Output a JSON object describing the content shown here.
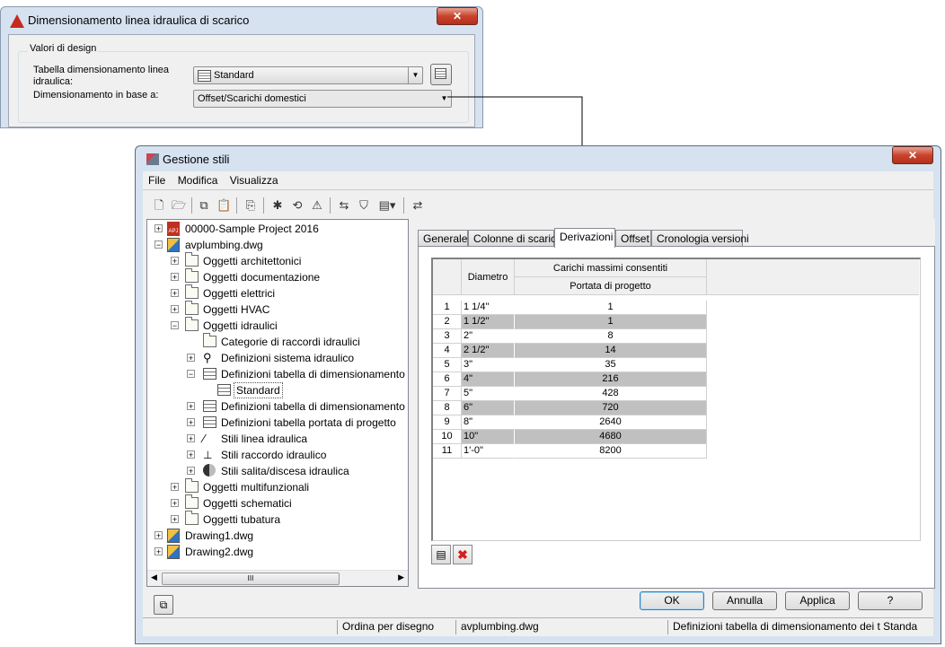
{
  "dialog1": {
    "title": "Dimensionamento linea idraulica di scarico",
    "close": "✕",
    "group_label": "Valori di design",
    "field1_label": "Tabella dimensionamento linea idraulica:",
    "field1_value": "Standard",
    "field2_label": "Dimensionamento in base a:",
    "field2_value": "Offset/Scarichi domestici"
  },
  "dialog2": {
    "title": "Gestione stili",
    "close": "✕",
    "menu": [
      "File",
      "Modifica",
      "Visualizza"
    ],
    "tree": [
      {
        "label": "00000-Sample Project 2016",
        "icon": "project-icon"
      },
      {
        "label": "avplumbing.dwg",
        "icon": "drawing-icon"
      },
      {
        "label": "Oggetti architettonici",
        "icon": "folder-icon"
      },
      {
        "label": "Oggetti documentazione",
        "icon": "folder-icon"
      },
      {
        "label": "Oggetti elettrici",
        "icon": "folder-icon"
      },
      {
        "label": "Oggetti HVAC",
        "icon": "folder-icon"
      },
      {
        "label": "Oggetti idraulici",
        "icon": "folder-icon"
      },
      {
        "label": "Categorie di raccordi idraulici",
        "icon": "category-icon"
      },
      {
        "label": "Definizioni sistema idraulico",
        "icon": "system-icon"
      },
      {
        "label": "Definizioni tabella di dimensionamento",
        "icon": "table-icon"
      },
      {
        "label": "Standard",
        "icon": "table-icon"
      },
      {
        "label": "Definizioni tabella di dimensionamento",
        "icon": "table-icon"
      },
      {
        "label": "Definizioni tabella portata di progetto",
        "icon": "table-icon"
      },
      {
        "label": "Stili linea idraulica",
        "icon": "pipe-icon"
      },
      {
        "label": "Stili raccordo idraulico",
        "icon": "fitting-icon"
      },
      {
        "label": "Stili salita/discesa idraulica",
        "icon": "riser-icon"
      },
      {
        "label": "Oggetti multifunzionali",
        "icon": "folder-icon"
      },
      {
        "label": "Oggetti schematici",
        "icon": "folder-icon"
      },
      {
        "label": "Oggetti tubatura",
        "icon": "folder-icon"
      },
      {
        "label": "Drawing1.dwg",
        "icon": "drawing-icon"
      },
      {
        "label": "Drawing2.dwg",
        "icon": "drawing-icon"
      }
    ],
    "scroll_grip": "III",
    "tabs": [
      "Generale",
      "Colonne di scarico",
      "Derivazioni",
      "Offset",
      "Cronologia versioni"
    ],
    "active_tab": "Derivazioni",
    "grid": {
      "col_diametro": "Diametro",
      "col_group": "Carichi massimi consentiti",
      "col_sub": "Portata di progetto",
      "rows": [
        {
          "n": "1",
          "d": "1 1/4\"",
          "v": "1"
        },
        {
          "n": "2",
          "d": "1 1/2\"",
          "v": "1"
        },
        {
          "n": "3",
          "d": "2\"",
          "v": "8"
        },
        {
          "n": "4",
          "d": "2 1/2\"",
          "v": "14"
        },
        {
          "n": "5",
          "d": "3\"",
          "v": "35"
        },
        {
          "n": "6",
          "d": "4\"",
          "v": "216"
        },
        {
          "n": "7",
          "d": "5\"",
          "v": "428"
        },
        {
          "n": "8",
          "d": "6\"",
          "v": "720"
        },
        {
          "n": "9",
          "d": "8\"",
          "v": "2640"
        },
        {
          "n": "10",
          "d": "10\"",
          "v": "4680"
        },
        {
          "n": "11",
          "d": "1'-0\"",
          "v": "8200"
        }
      ]
    },
    "buttons": {
      "ok": "OK",
      "cancel": "Annulla",
      "apply": "Applica",
      "help": "?"
    },
    "status": {
      "sort": "Ordina per disegno",
      "file": "avplumbing.dwg",
      "path": "Definizioni tabella di dimensionamento dei t  Standa"
    }
  }
}
